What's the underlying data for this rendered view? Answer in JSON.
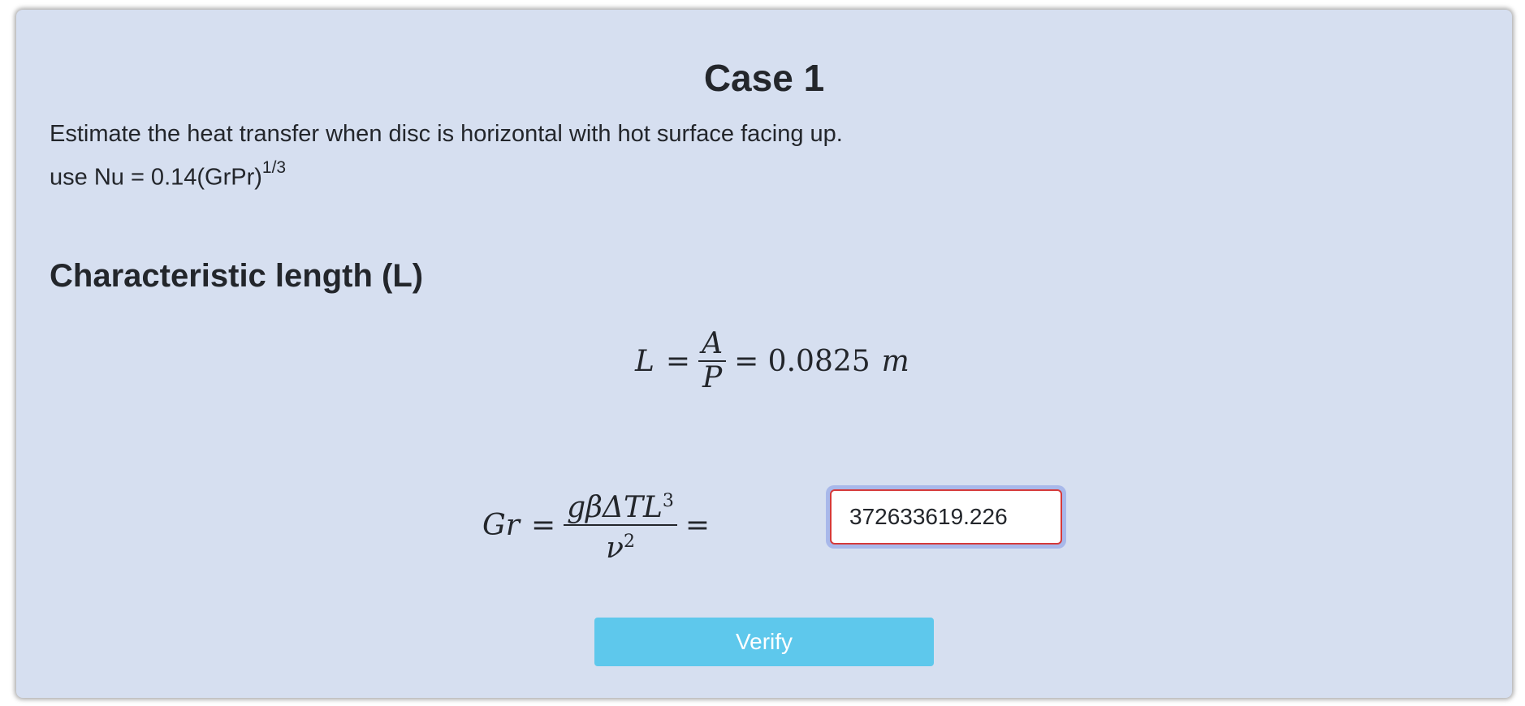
{
  "case": {
    "title": "Case 1",
    "statement": "Estimate the heat transfer when disc is horizontal with hot surface facing up.",
    "hint_prefix": "use Nu = 0.14(GrPr)",
    "hint_exponent": "1/3"
  },
  "section": {
    "heading": "Characteristic length (L)"
  },
  "equation_L": {
    "lhs": "L",
    "equals": "=",
    "numerator": "A",
    "denominator": "P",
    "result": "= 0.0825",
    "unit": "m"
  },
  "equation_Gr": {
    "lhs": "Gr",
    "equals": "=",
    "numerator_main": "gβΔTL",
    "numerator_exp": "3",
    "denominator_main": "ν",
    "denominator_exp": "2",
    "trailing_equals": "="
  },
  "answer": {
    "value": "372633619.226",
    "state": "invalid"
  },
  "verify_button": {
    "label": "Verify"
  }
}
